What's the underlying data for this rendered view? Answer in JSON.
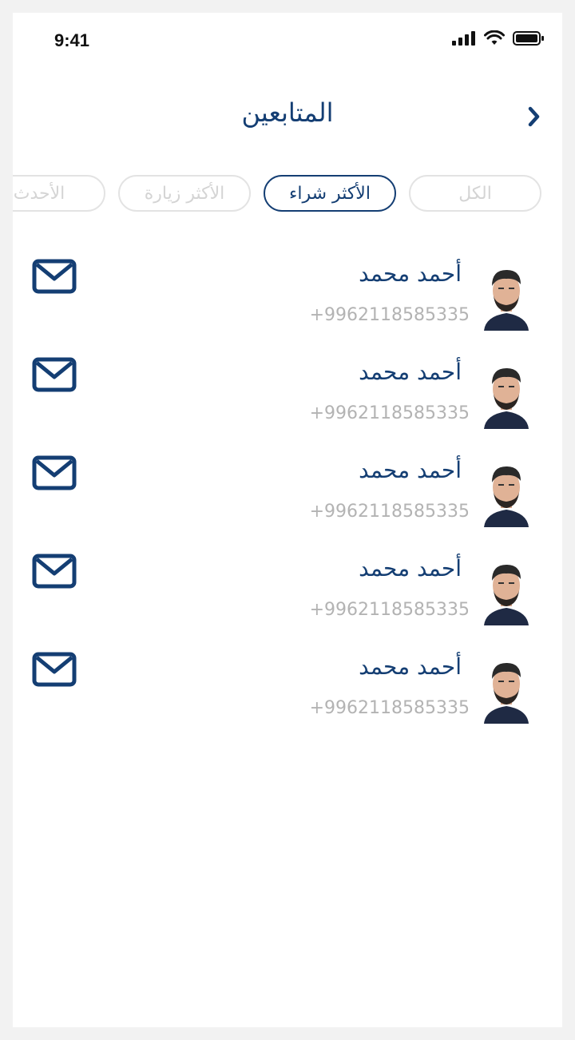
{
  "status_bar": {
    "time": "9:41"
  },
  "header": {
    "title": "المتابعين",
    "back_icon": "chevron-right-icon"
  },
  "filters": [
    {
      "label": "الكل",
      "active": false
    },
    {
      "label": "الأكثر شراء",
      "active": true
    },
    {
      "label": "الأكثر زيارة",
      "active": false
    },
    {
      "label": "الأحدث",
      "active": false
    }
  ],
  "followers": [
    {
      "name": "أحمد محمد",
      "phone": "+9962118585335",
      "action_icon": "envelope-icon"
    },
    {
      "name": "أحمد محمد",
      "phone": "+9962118585335",
      "action_icon": "envelope-icon"
    },
    {
      "name": "أحمد محمد",
      "phone": "+9962118585335",
      "action_icon": "envelope-icon"
    },
    {
      "name": "أحمد محمد",
      "phone": "+9962118585335",
      "action_icon": "envelope-icon"
    },
    {
      "name": "أحمد محمد",
      "phone": "+9962118585335",
      "action_icon": "envelope-icon"
    }
  ],
  "colors": {
    "primary": "#143e73",
    "muted_text": "#b3b3b3",
    "inactive_border": "#e3e3e3"
  }
}
